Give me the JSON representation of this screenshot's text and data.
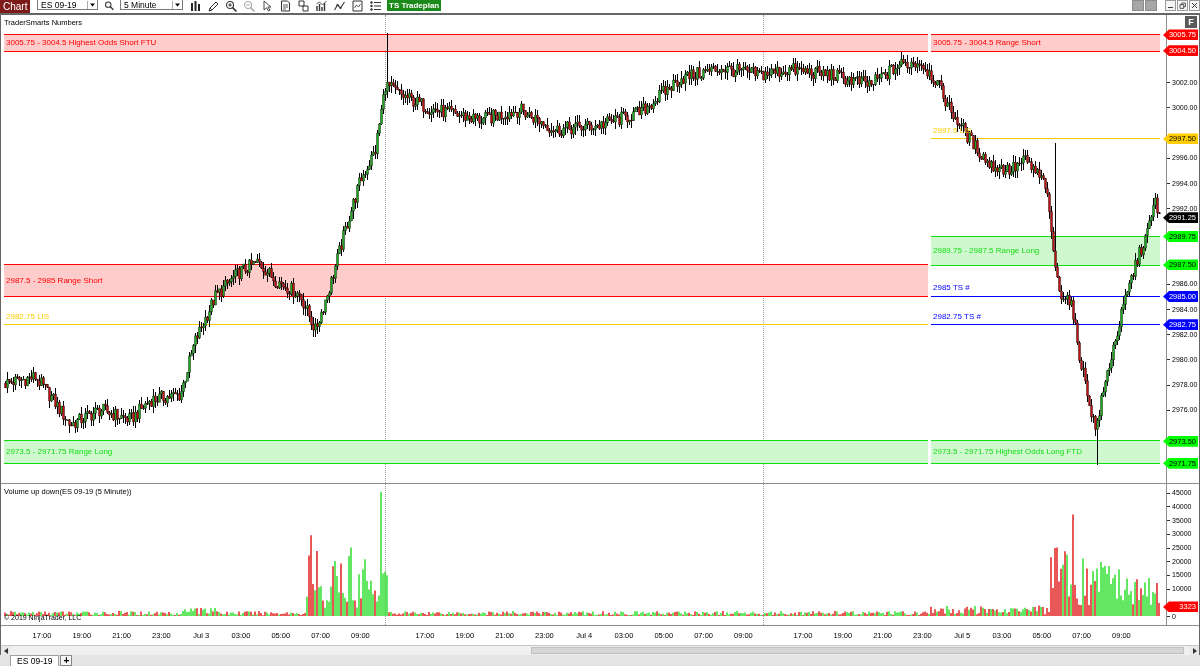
{
  "toolbar": {
    "chart_tab": "Chart",
    "instrument": "ES 09-19",
    "interval": "5 Minute",
    "tradeplan_button": "TS Tradeplan"
  },
  "price_panel": {
    "title": "TraderSmarts Numbers",
    "format_button": "F",
    "levels": {
      "left": [
        {
          "kind": "zone",
          "label": "3005.75 - 3004.5 Highest Odds Short FTU",
          "color": "#ff0000"
        },
        {
          "kind": "zone",
          "label": "2987.5 - 2985 Range Short",
          "color": "#ff0000"
        },
        {
          "kind": "line",
          "label": "2982.75 LIS",
          "color": "#ffcc00"
        },
        {
          "kind": "zone",
          "label": "2973.5 - 2971.75 Range Long",
          "color": "#11dd11"
        }
      ],
      "right": [
        {
          "kind": "zone",
          "label": "3005.75 - 3004.5 Range Short",
          "color": "#ff0000"
        },
        {
          "kind": "line",
          "label": "2997.5 LIS",
          "color": "#ffcc00"
        },
        {
          "kind": "zone",
          "label": "2989.75 - 2987.5 Range Long",
          "color": "#11dd11"
        },
        {
          "kind": "line",
          "label": "2985 TS #",
          "color": "#0000ff"
        },
        {
          "kind": "line",
          "label": "2982.75 TS #",
          "color": "#0000ff"
        },
        {
          "kind": "zone",
          "label": "2973.5 - 2971.75 Highest Odds Long FTD",
          "color": "#11dd11"
        }
      ]
    },
    "axis_ticks": [
      "3002.00",
      "3000.00",
      "2996.00",
      "2994.00",
      "2992.00",
      "2986.00",
      "2984.00",
      "2982.00",
      "2980.00",
      "2978.00",
      "2976.00"
    ],
    "price_tags": [
      {
        "label": "3005.75",
        "color": "#ff0000"
      },
      {
        "label": "3004.50",
        "color": "#ff0000"
      },
      {
        "label": "2997.50",
        "color": "#ffcc00"
      },
      {
        "label": "2991.25",
        "color": "#000000"
      },
      {
        "label": "2989.75",
        "color": "#00ff00"
      },
      {
        "label": "2987.50",
        "color": "#00ff00"
      },
      {
        "label": "2985.00",
        "color": "#0000ff"
      },
      {
        "label": "2982.75",
        "color": "#0000ff"
      },
      {
        "label": "2973.50",
        "color": "#00ff00"
      },
      {
        "label": "2971.75",
        "color": "#00ff00"
      }
    ]
  },
  "volume_panel": {
    "title": "Volume up down(ES 09-19 (5 Minute))",
    "copyright": "© 2019 NinjaTrader, LLC",
    "axis_ticks": [
      "45000",
      "40000",
      "35000",
      "30000",
      "25000",
      "20000",
      "15000",
      "10000",
      "0"
    ],
    "volume_tag": {
      "label": "3323",
      "color": "#ff0000"
    }
  },
  "time_axis": {
    "sessions": [
      {
        "labels": [
          "17:00",
          "19:00",
          "21:00",
          "23:00",
          "Jul 3",
          "03:00",
          "05:00",
          "07:00",
          "09:00"
        ]
      },
      {
        "labels": [
          "17:00",
          "19:00",
          "21:00",
          "23:00",
          "Jul 4",
          "03:00",
          "05:00",
          "07:00",
          "09:00"
        ]
      },
      {
        "labels": [
          "17:00",
          "19:00",
          "21:00",
          "23:00",
          "Jul 5",
          "03:00",
          "05:00",
          "07:00",
          "09:00"
        ]
      }
    ]
  },
  "tabs": [
    {
      "label": "ES 09-19",
      "selected": true
    }
  ],
  "add_tab_button": "+"
}
